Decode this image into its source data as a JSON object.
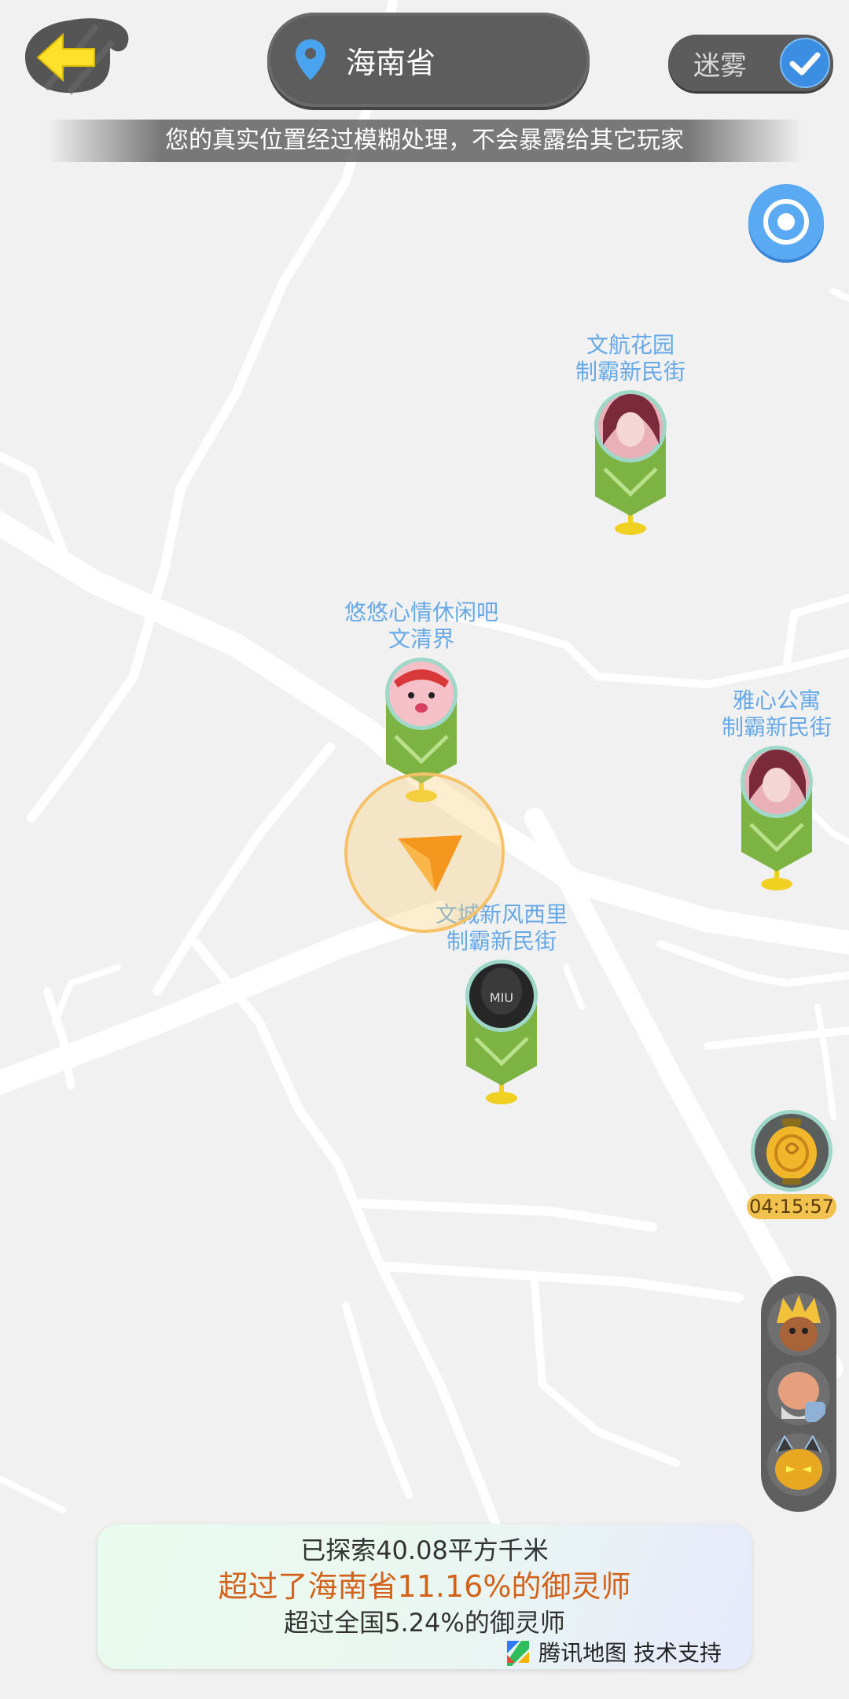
{
  "header": {
    "location": "海南省",
    "fog_toggle_label": "迷雾",
    "fog_enabled": true,
    "privacy_notice": "您的真实位置经过模糊处理，不会暴露给其它玩家"
  },
  "markers": [
    {
      "name_line1": "文航花园",
      "name_line2": "制霸新民街",
      "avatar": "pink-hair-girl"
    },
    {
      "name_line1": "悠悠心情休闲吧",
      "name_line2": "文清界",
      "avatar": "pink-creature"
    },
    {
      "name_line1": "雅心公寓",
      "name_line2": "制霸新民街",
      "avatar": "pink-hair-girl"
    },
    {
      "name_line1": "文城新风西里",
      "name_line2": "制霸新民街",
      "avatar": "dark-photo"
    }
  ],
  "avatar_texts": {
    "dark_photo": "MIU"
  },
  "timer": "04:15:57",
  "characters": [
    "lion-warrior",
    "old-sage",
    "pumpkin-cat"
  ],
  "stats": {
    "explored": "已探索40.08平方千米",
    "province_rank": "超过了海南省11.16%的御灵师",
    "national_rank": "超过全国5.24%的御灵师"
  },
  "attribution": "腾讯地图 技术支持",
  "colors": {
    "accent_blue": "#3c8ee3",
    "marker_green": "#7db342",
    "rank_orange": "#d2621a"
  }
}
